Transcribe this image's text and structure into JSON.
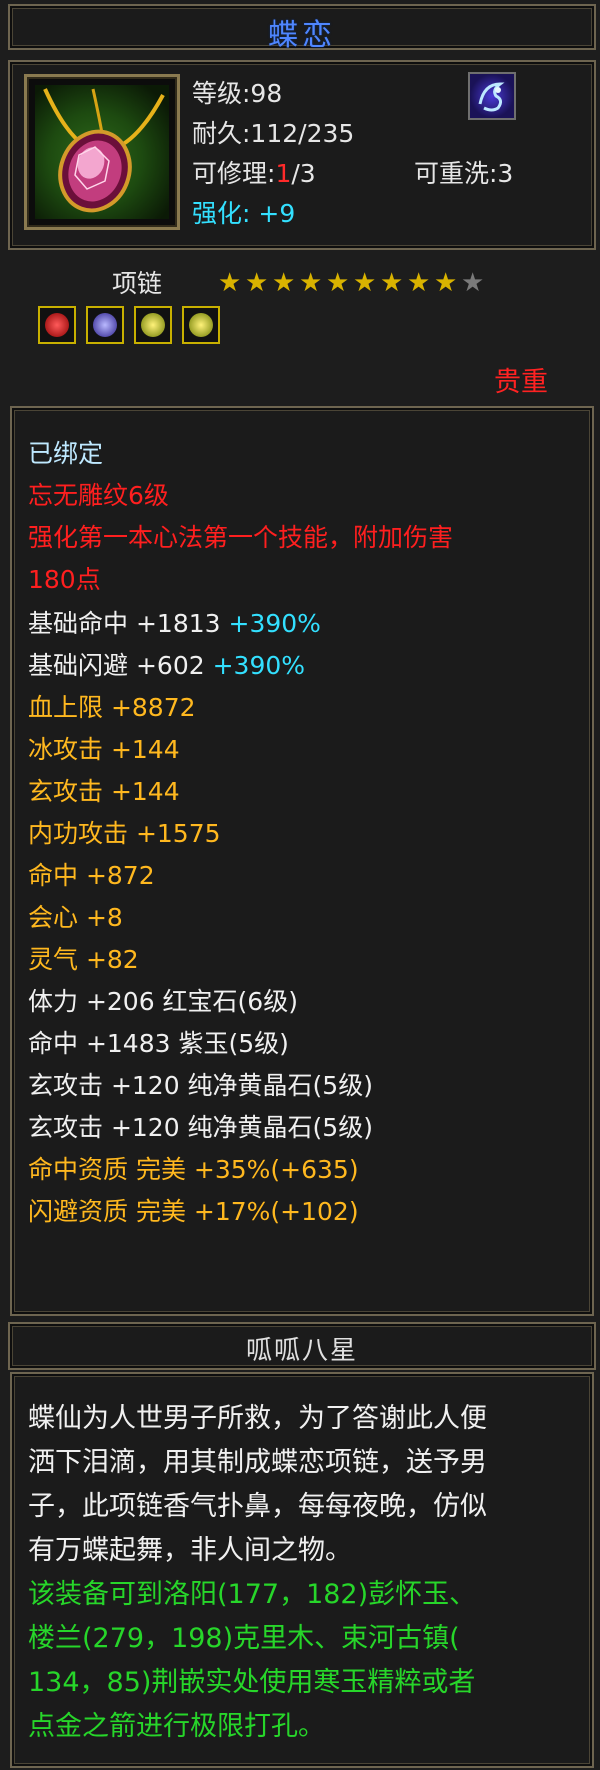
{
  "title": "蝶恋",
  "item": {
    "level_label": "等级:98",
    "durability_label": "耐久:112/235",
    "repair_prefix": "可修理:",
    "repair_current": "1",
    "repair_total": "/3",
    "rewash_label": "可重洗:3",
    "enhance_label": "强化:",
    "enhance_value": "+9",
    "type": "项链",
    "stars_filled": 9,
    "stars_total": 10,
    "rarity": "贵重"
  },
  "stats": {
    "bound": "已绑定",
    "engrave": "忘无雕纹6级",
    "effect_line1": "强化第一本心法第一个技能，附加伤害",
    "effect_line2": "180点",
    "base_lines": [
      {
        "label": "基础命中",
        "value": "+1813",
        "pct": "+390%"
      },
      {
        "label": "基础闪避",
        "value": "+602",
        "pct": "+390%"
      }
    ],
    "attrs": [
      "血上限 +8872",
      "冰攻击 +144",
      "玄攻击 +144",
      "内功攻击 +1575",
      "命中 +872",
      "会心 +8",
      "灵气 +82"
    ],
    "gems": [
      "体力 +206 红宝石(6级)",
      "命中 +1483 紫玉(5级)",
      "玄攻击 +120 纯净黄晶石(5级)",
      "玄攻击 +120 纯净黄晶石(5级)"
    ],
    "aptitudes": [
      "命中资质   完美 +35%(+635)",
      "闪避资质   完美 +17%(+102)"
    ]
  },
  "subtitle": "呱呱八星",
  "description": {
    "story": [
      "蝶仙为人世男子所救，为了答谢此人便",
      "洒下泪滴，用其制成蝶恋项链，送予男",
      "子，此项链香气扑鼻，每每夜晚，仿似",
      "有万蝶起舞，非人间之物。"
    ],
    "hint": [
      "该装备可到洛阳(177，182)彭怀玉、",
      "楼兰(279，198)克里木、束河古镇(",
      "134，85)荆嵌实处使用寒玉精粹或者",
      "点金之箭进行极限打孔。"
    ]
  },
  "colors": {
    "title": "#4f86ff",
    "cyan": "#33e0ff",
    "red": "#ff1f1f",
    "orange": "#ffb81f",
    "green": "#27d62a",
    "star_gold": "#d9b300",
    "star_gray": "#7a7a7a"
  },
  "icons": [
    "necklace-icon",
    "spirit-icon",
    "star-icon",
    "gem-socket-icon"
  ]
}
